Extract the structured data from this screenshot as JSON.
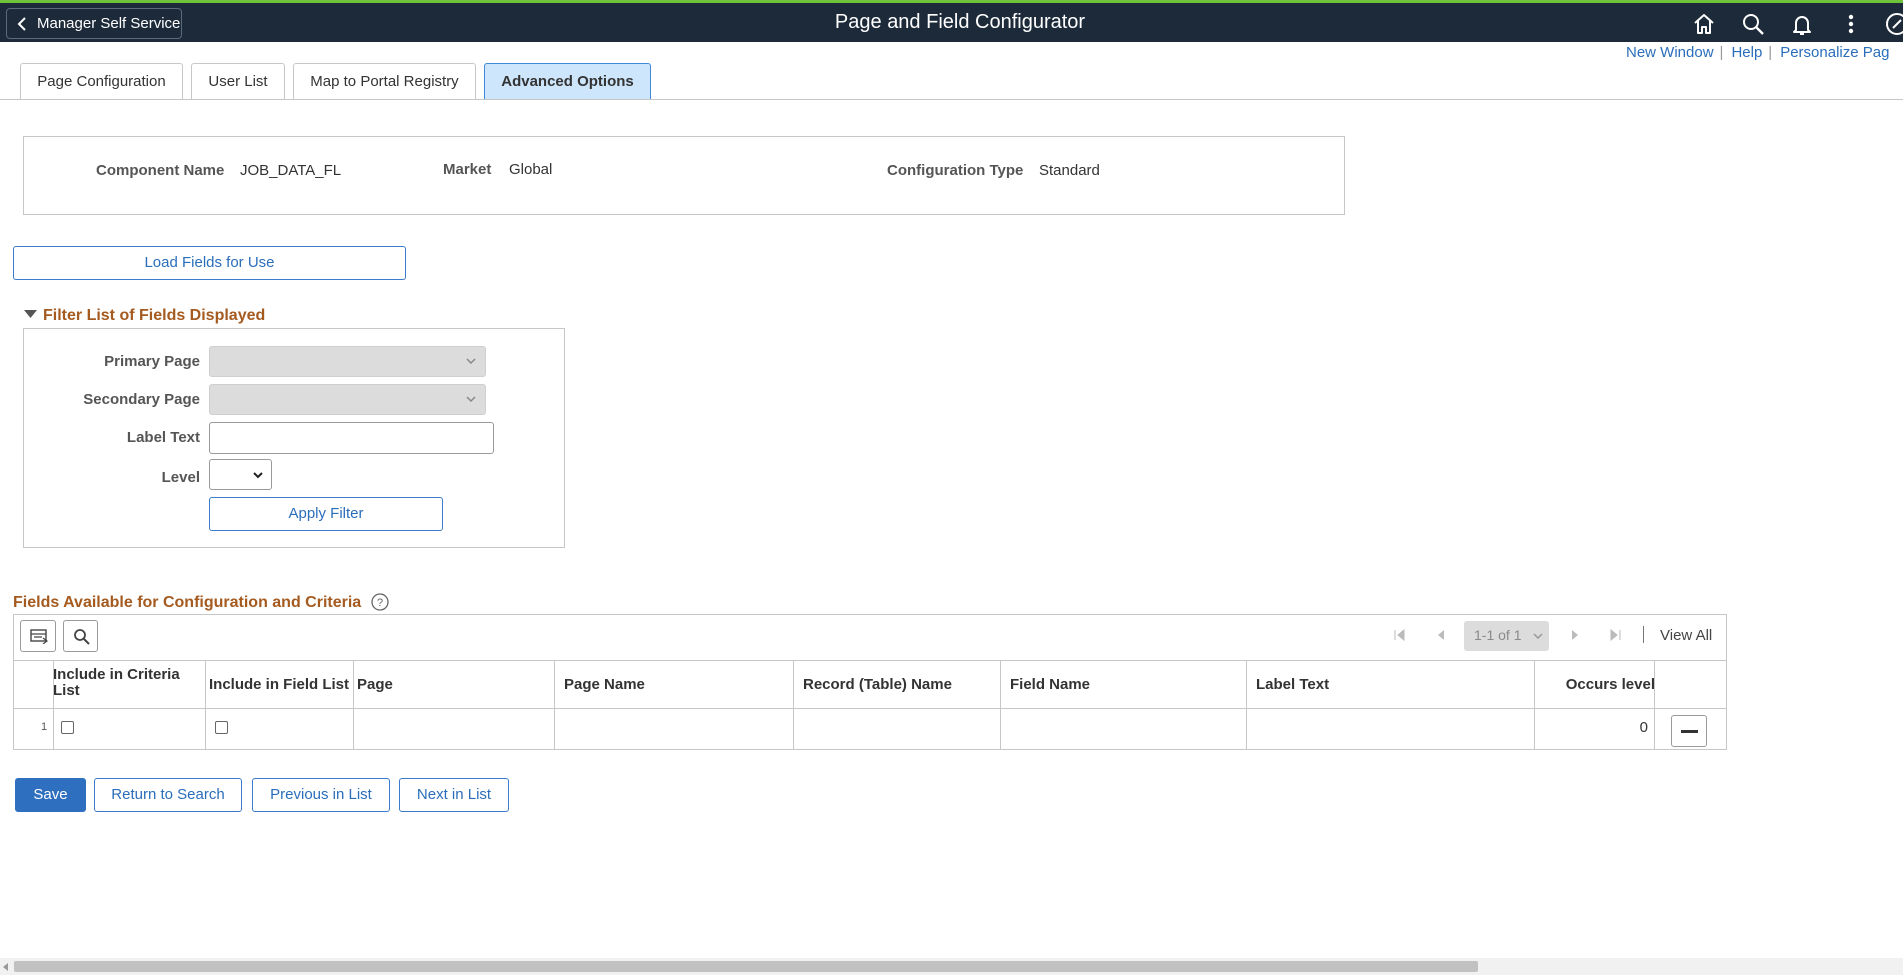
{
  "header": {
    "back_label": "Manager Self Service",
    "title": "Page and Field Configurator",
    "icons": [
      "home-icon",
      "search-icon",
      "notifications-icon",
      "actions-menu-icon",
      "navbar-icon"
    ]
  },
  "links": {
    "new_window": "New Window",
    "help": "Help",
    "personalize": "Personalize Pag"
  },
  "tabs": [
    {
      "label": "Page Configuration",
      "active": false
    },
    {
      "label": "User List",
      "active": false
    },
    {
      "label": "Map to Portal Registry",
      "active": false
    },
    {
      "label": "Advanced Options",
      "active": true
    }
  ],
  "component": {
    "name_label": "Component Name",
    "name_value": "JOB_DATA_FL",
    "market_label": "Market",
    "market_value": "Global",
    "config_type_label": "Configuration Type",
    "config_type_value": "Standard"
  },
  "load_fields_button": "Load Fields for Use",
  "filter": {
    "title": "Filter List of Fields Displayed",
    "primary_page_label": "Primary Page",
    "secondary_page_label": "Secondary Page",
    "label_text_label": "Label Text",
    "level_label": "Level",
    "apply_button": "Apply Filter"
  },
  "grid": {
    "title": "Fields Available for Configuration and Criteria",
    "pager": "1-1 of 1",
    "view_all": "View All",
    "columns": [
      "Include in Criteria List",
      "Include in Field List",
      "Page",
      "Page Name",
      "Record (Table) Name",
      "Field Name",
      "Label Text",
      "Occurs level"
    ],
    "rows": [
      {
        "num": "1",
        "page": "",
        "page_name": "",
        "record": "",
        "field": "",
        "label": "",
        "occurs": "0"
      }
    ]
  },
  "footer": {
    "save": "Save",
    "return_to_search": "Return to Search",
    "previous": "Previous in List",
    "next": "Next in List"
  },
  "colors": {
    "banner": "#1c2a3a",
    "accent": "#2f6fbf",
    "section_title": "#a55a1f",
    "active_tab": "#cde6fb"
  }
}
